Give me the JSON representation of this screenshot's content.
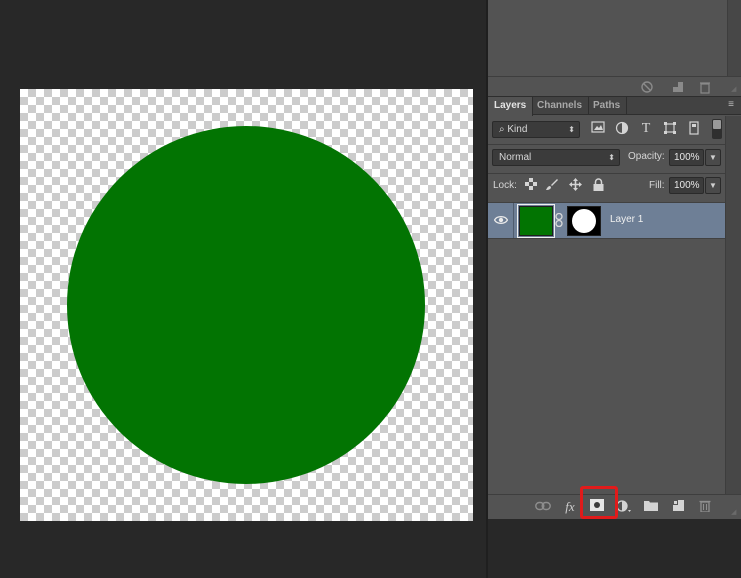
{
  "canvas": {
    "shape_color": "#027402"
  },
  "layers_panel": {
    "tabs": [
      "Layers",
      "Channels",
      "Paths"
    ],
    "active_tab": "Layers",
    "filter": {
      "kind_label": "Kind"
    },
    "blend_mode": "Normal",
    "opacity_label": "Opacity:",
    "opacity_value": "100%",
    "lock_label": "Lock:",
    "fill_label": "Fill:",
    "fill_value": "100%",
    "layers": [
      {
        "name": "Layer 1",
        "visible": true,
        "thumb_color": "#027402",
        "has_mask": true
      }
    ]
  },
  "icons": {
    "filter": [
      "image-filter-icon",
      "adjustment-filter-icon",
      "type-filter-icon",
      "shape-filter-icon",
      "smart-object-filter-icon"
    ],
    "bottom_bar": [
      "link-layers-icon",
      "fx-icon",
      "add-mask-icon",
      "adjustment-layer-icon",
      "new-group-icon",
      "new-layer-icon",
      "trash-icon"
    ]
  },
  "fx_text": "fx",
  "highlighted_tool": "add-mask-icon",
  "highlight_color": "#e11b1b"
}
